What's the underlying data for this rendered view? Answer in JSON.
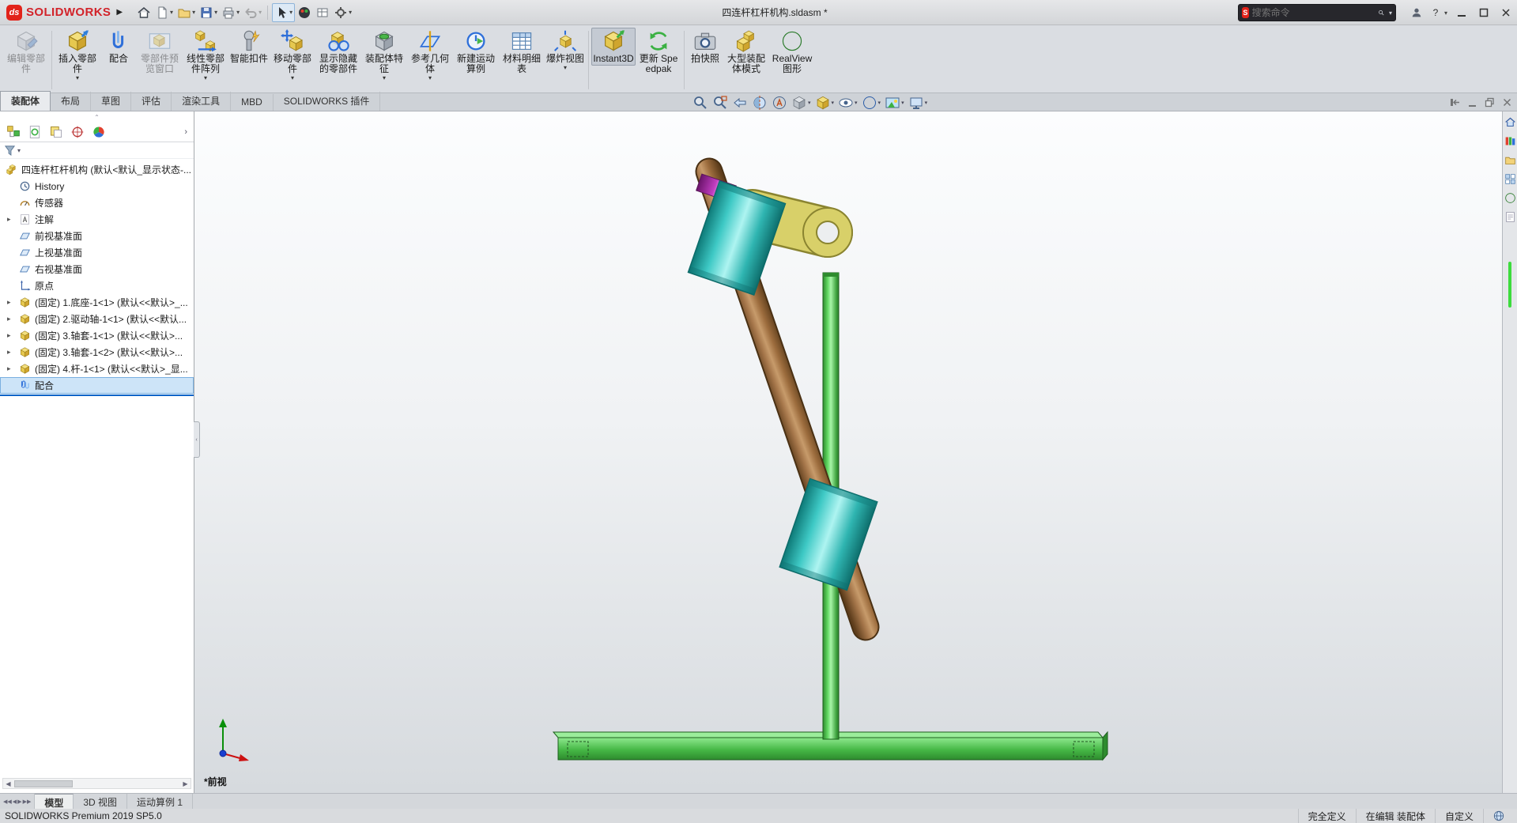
{
  "app": {
    "name": "SOLIDWORKS",
    "logo_badge": "ds"
  },
  "title_bar": {
    "document_title": "四连杆杠杆机构.sldasm *",
    "search_placeholder": "搜索命令",
    "help_label": "?",
    "quick_tool_icons": [
      "home-icon",
      "new-document-icon",
      "open-icon",
      "save-icon",
      "print-icon",
      "undo-icon",
      "select-icon",
      "view-sphere-icon",
      "options-grid-icon",
      "settings-gear-icon"
    ]
  },
  "ribbon": {
    "buttons": [
      {
        "label": "编辑零部件",
        "state": "disabled"
      },
      {
        "label": "插入零部件",
        "dropdown": true
      },
      {
        "label": "配合"
      },
      {
        "label": "零部件预览窗口",
        "state": "disabled"
      },
      {
        "label": "线性零部件阵列",
        "dropdown": true
      },
      {
        "label": "智能扣件"
      },
      {
        "label": "移动零部件",
        "dropdown": true
      },
      {
        "label": "显示隐藏的零部件"
      },
      {
        "label": "装配体特征",
        "dropdown": true
      },
      {
        "label": "参考几何体",
        "dropdown": true
      },
      {
        "label": "新建运动算例"
      },
      {
        "label": "材料明细表"
      },
      {
        "label": "爆炸视图",
        "dropdown": true
      },
      {
        "label": "Instant3D",
        "state": "active"
      },
      {
        "label": "更新 Speedpak"
      },
      {
        "label": "拍快照"
      },
      {
        "label": "大型装配体模式"
      },
      {
        "label": "RealView 图形"
      }
    ]
  },
  "command_tabs": [
    "装配体",
    "布局",
    "草图",
    "评估",
    "渲染工具",
    "MBD",
    "SOLIDWORKS 插件"
  ],
  "active_command_tab": "装配体",
  "headsup_icons": [
    "zoom-fit-icon",
    "zoom-area-icon",
    "previous-view-icon",
    "section-view-icon",
    "annotation-view-icon",
    "view-orientation-icon",
    "display-style-icon",
    "hide-show-items-icon",
    "edit-appearance-icon",
    "apply-scene-icon",
    "view-settings-icon"
  ],
  "feature_tree": {
    "panel_tab_icons": [
      "featuremanager-icon",
      "propertymanager-icon",
      "configurationmanager-icon",
      "dimxpertmanager-icon",
      "displaymanager-icon"
    ],
    "items": [
      {
        "label": "四连杆杠杆机构 (默认<默认_显示状态-..."
      },
      {
        "label": "History"
      },
      {
        "label": "传感器"
      },
      {
        "label": "注解"
      },
      {
        "label": "前视基准面"
      },
      {
        "label": "上视基准面"
      },
      {
        "label": "右视基准面"
      },
      {
        "label": "原点"
      },
      {
        "label": "(固定) 1.底座-1<1> (默认<<默认>_..."
      },
      {
        "label": "(固定) 2.驱动轴-1<1> (默认<<默认..."
      },
      {
        "label": "(固定) 3.轴套-1<1> (默认<<默认>..."
      },
      {
        "label": "(固定) 3.轴套-1<2> (默认<<默认>..."
      },
      {
        "label": "(固定) 4.杆-1<1> (默认<<默认>_显..."
      },
      {
        "label": "配合"
      }
    ]
  },
  "viewport": {
    "view_label": "*前视",
    "model_colors": {
      "base": "#4fc24f",
      "column": "#4fc24f",
      "rod": "#a97c50",
      "bushings": "#59dbd6",
      "link": "#d8d069",
      "collar": "#a835a8"
    }
  },
  "task_pane_icons": [
    "resources-home-icon",
    "design-library-icon",
    "file-explorer-icon",
    "view-palette-icon",
    "appearances-icon",
    "custom-properties-icon"
  ],
  "bottom_tabs": {
    "tabs": [
      "模型",
      "3D 视图",
      "运动算例 1"
    ],
    "active": "模型"
  },
  "status_bar": {
    "left": "SOLIDWORKS Premium 2019 SP5.0",
    "define_state": "完全定义",
    "editing_state": "在编辑 装配体",
    "custom_label": "自定义"
  }
}
